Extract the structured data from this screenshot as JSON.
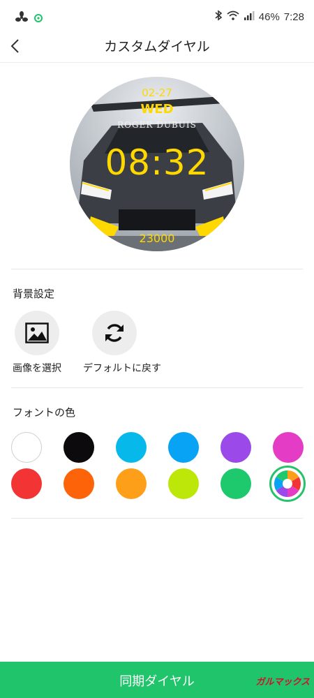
{
  "status_bar": {
    "battery": "46%",
    "time": "7:28"
  },
  "header": {
    "title": "カスタムダイヤル"
  },
  "dial": {
    "date": "02-27",
    "day": "WED",
    "brand": "ROGER DUBUIS",
    "time": "08:32",
    "steps": "23000"
  },
  "background": {
    "label": "背景設定",
    "select_image": "画像を選択",
    "reset_default": "デフォルトに戻す"
  },
  "font_color": {
    "label": "フォントの色",
    "colors": [
      "#ffffff",
      "#0c0a0c",
      "#07b9ea",
      "#09a3f6",
      "#9b4ae9",
      "#e43cc4",
      "#f23434",
      "#fd6308",
      "#fd9f19",
      "#bce709",
      "#1ec96e"
    ],
    "selected": "picker"
  },
  "footer": {
    "sync_label": "同期ダイヤル",
    "watermark": "ガルマックス"
  }
}
